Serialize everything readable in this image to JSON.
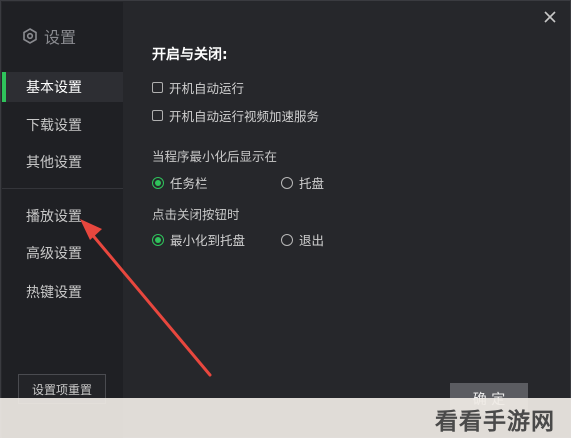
{
  "sidebar": {
    "title": "设置",
    "items": [
      {
        "label": "基本设置"
      },
      {
        "label": "下载设置"
      },
      {
        "label": "其他设置"
      },
      {
        "label": "播放设置"
      },
      {
        "label": "高级设置"
      },
      {
        "label": "热键设置"
      }
    ],
    "reset_label": "设置项重置"
  },
  "main": {
    "section_title": "开启与关闭:",
    "checkboxes": [
      {
        "label": "开机自动运行",
        "checked": false
      },
      {
        "label": "开机自动运行视频加速服务",
        "checked": false
      }
    ],
    "minimize_group": {
      "label": "当程序最小化后显示在",
      "options": [
        {
          "label": "任务栏",
          "selected": true
        },
        {
          "label": "托盘",
          "selected": false
        }
      ]
    },
    "close_group": {
      "label": "点击关闭按钮时",
      "options": [
        {
          "label": "最小化到托盘",
          "selected": true
        },
        {
          "label": "退出",
          "selected": false
        }
      ]
    },
    "ok_label": "确 定"
  },
  "watermark": {
    "text": "看看手游网"
  },
  "colors": {
    "accent": "#2fc35b",
    "arrow": "#e8473e",
    "background": "#26272b"
  }
}
